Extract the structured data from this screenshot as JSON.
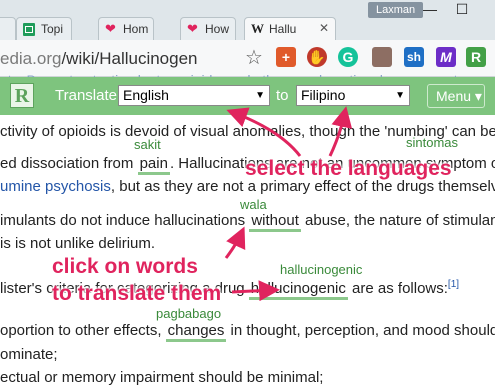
{
  "browser": {
    "tabs": [
      {
        "label": "…"
      },
      {
        "label": "Topi"
      },
      {
        "label": "Hom"
      },
      {
        "label": "How"
      },
      {
        "label": "Hallu"
      }
    ],
    "user": "Laxman",
    "window_controls": {
      "minimize": "—",
      "maximize": "☐",
      "close": "✕"
    },
    "url_prefix": "edia.org",
    "url_path": "/wiki/Hallucinogen",
    "extensions": [
      {
        "label": "+",
        "color": "#e05a2b"
      },
      {
        "label": "✋",
        "color": "#c0392b"
      },
      {
        "label": "G",
        "color": "#15c39a"
      },
      {
        "label": "",
        "color": "#8d6e63"
      },
      {
        "label": "sh",
        "color": "#1f6fc5"
      },
      {
        "label": "M",
        "color": "#6c2dc7"
      },
      {
        "label": "R",
        "color": "#43a047"
      }
    ]
  },
  "translator": {
    "logo": "R",
    "translate_label": "Translate",
    "source_language": "English",
    "to_label": "to",
    "target_language": "Filipino",
    "menu_label": "Menu ▾"
  },
  "article": {
    "faded_top": "nts. By contrast, stimulants, opioids, and other psychoactive drugs are not",
    "line1": "ctivity of opioids is devoid of visual anomalies, though the 'numbing' can be",
    "line2_pre": "ed dissociation from ",
    "line2_word": "pain",
    "line2_post": ". Hallucinations are not an uncommon symptom of",
    "line3_link": "umine psychosis",
    "line3_post": ", but as they are not a primary effect of the drugs themselves.",
    "line4_pre": "imulants do not induce hallucinations ",
    "line4_word": "without",
    "line4_post": " abuse, the nature of stimulant",
    "line5": "is is not unlike delirium.",
    "line6_pre": "lister's criteria for categorizing a drug ",
    "line6_word": "hallucinogenic",
    "line6_post": " are as follows:",
    "line6_sup": "[1]",
    "line7_pre": "oportion to other effects, ",
    "line7_word": "changes",
    "line7_post": " in thought, perception, and mood should",
    "line8": "ominate;",
    "line9": "ectual or memory impairment should be minimal;"
  },
  "translations": {
    "pain": "sakit",
    "symptom": "sintomas",
    "without": "wala",
    "hallucinogenic": "hallucinogenic",
    "changes": "pagbabago"
  },
  "annotations": {
    "select_languages": "select the languages",
    "click_words_1": "click on words",
    "click_words_2": "to translate them",
    "color": "#e0245e"
  }
}
